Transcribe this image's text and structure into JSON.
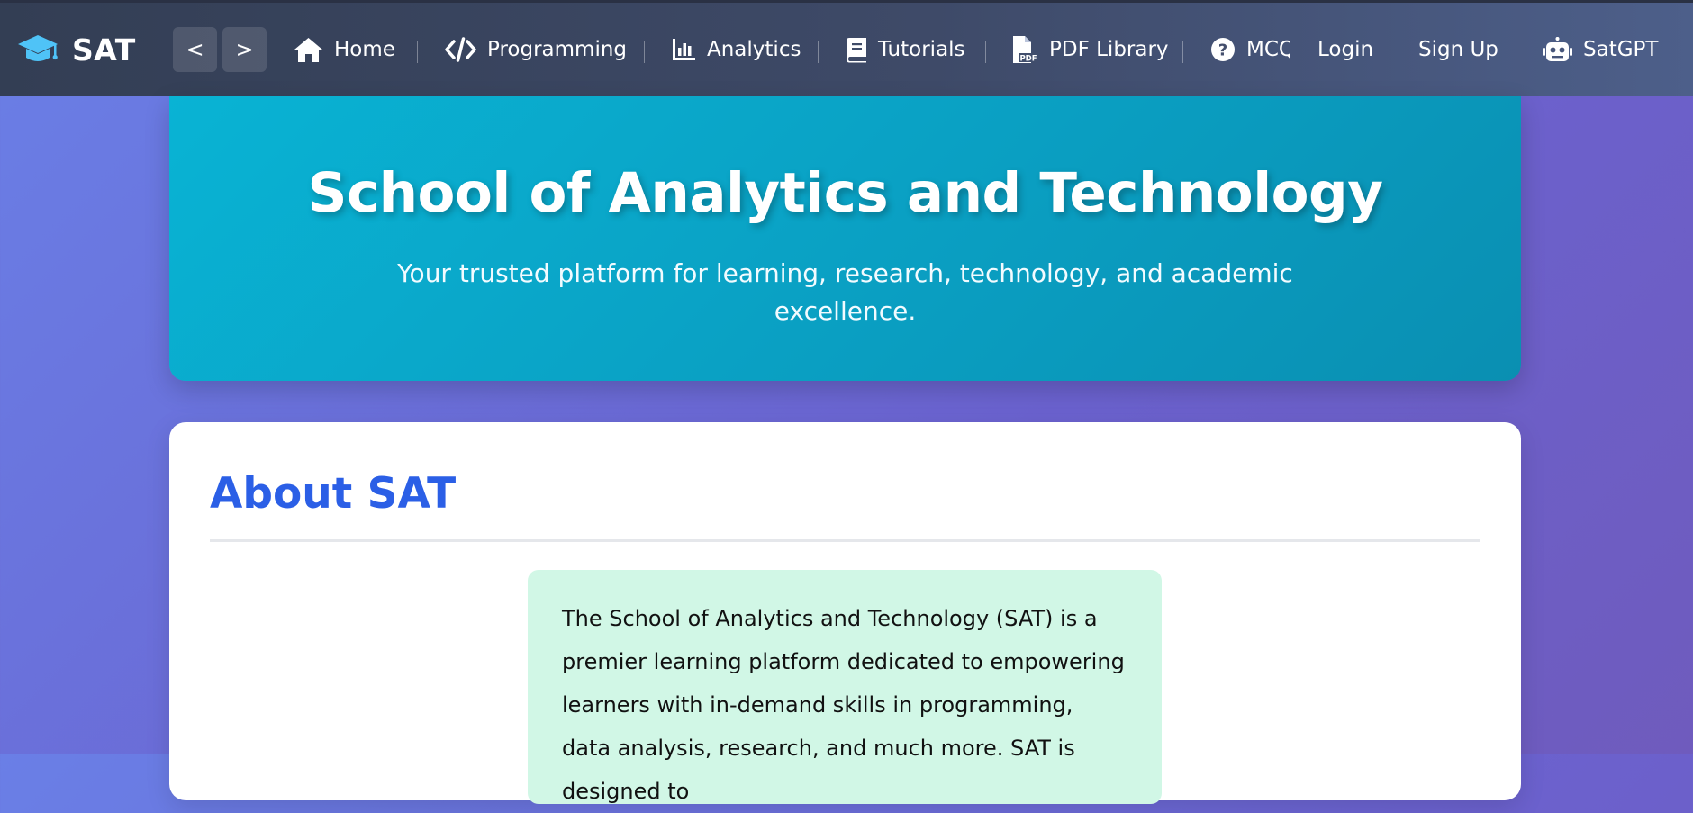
{
  "brand": {
    "name": "SAT",
    "icon": "graduation-cap-icon",
    "icon_color": "#4fc3f7"
  },
  "nav": {
    "back_label": "<",
    "forward_label": ">",
    "items": [
      {
        "label": "Home",
        "icon": "home-icon"
      },
      {
        "label": "Programming",
        "icon": "code-icon"
      },
      {
        "label": "Analytics",
        "icon": "chart-bar-icon"
      },
      {
        "label": "Tutorials",
        "icon": "book-icon"
      },
      {
        "label": "PDF Library",
        "icon": "pdf-file-icon"
      },
      {
        "label": "MCQ",
        "icon": "question-circle-icon"
      }
    ],
    "login_label": "Login",
    "signup_label": "Sign Up",
    "satgpt_label": "SatGPT",
    "satgpt_icon": "robot-icon"
  },
  "hero": {
    "title": "School of Analytics and Technology",
    "subtitle": "Your trusted platform for learning, research, technology, and academic excellence."
  },
  "about": {
    "title": "About SAT",
    "text": "The School of Analytics and Technology (SAT) is a premier learning platform dedicated to empowering learners with in-demand skills in programming, data analysis, research, and much more. SAT is designed to"
  },
  "colors": {
    "nav_bg": "#3a4560",
    "hero_bg": "#0aa5c8",
    "heading_blue": "#2b5fe6",
    "about_box_bg": "#d1f7e6"
  }
}
